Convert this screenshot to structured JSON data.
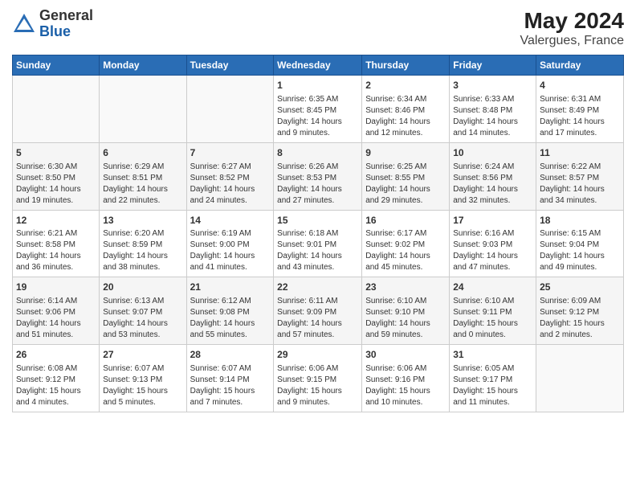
{
  "header": {
    "logo_general": "General",
    "logo_blue": "Blue",
    "month": "May 2024",
    "location": "Valergues, France"
  },
  "days_of_week": [
    "Sunday",
    "Monday",
    "Tuesday",
    "Wednesday",
    "Thursday",
    "Friday",
    "Saturday"
  ],
  "weeks": [
    [
      {
        "day": "",
        "content": ""
      },
      {
        "day": "",
        "content": ""
      },
      {
        "day": "",
        "content": ""
      },
      {
        "day": "1",
        "content": "Sunrise: 6:35 AM\nSunset: 8:45 PM\nDaylight: 14 hours\nand 9 minutes."
      },
      {
        "day": "2",
        "content": "Sunrise: 6:34 AM\nSunset: 8:46 PM\nDaylight: 14 hours\nand 12 minutes."
      },
      {
        "day": "3",
        "content": "Sunrise: 6:33 AM\nSunset: 8:48 PM\nDaylight: 14 hours\nand 14 minutes."
      },
      {
        "day": "4",
        "content": "Sunrise: 6:31 AM\nSunset: 8:49 PM\nDaylight: 14 hours\nand 17 minutes."
      }
    ],
    [
      {
        "day": "5",
        "content": "Sunrise: 6:30 AM\nSunset: 8:50 PM\nDaylight: 14 hours\nand 19 minutes."
      },
      {
        "day": "6",
        "content": "Sunrise: 6:29 AM\nSunset: 8:51 PM\nDaylight: 14 hours\nand 22 minutes."
      },
      {
        "day": "7",
        "content": "Sunrise: 6:27 AM\nSunset: 8:52 PM\nDaylight: 14 hours\nand 24 minutes."
      },
      {
        "day": "8",
        "content": "Sunrise: 6:26 AM\nSunset: 8:53 PM\nDaylight: 14 hours\nand 27 minutes."
      },
      {
        "day": "9",
        "content": "Sunrise: 6:25 AM\nSunset: 8:55 PM\nDaylight: 14 hours\nand 29 minutes."
      },
      {
        "day": "10",
        "content": "Sunrise: 6:24 AM\nSunset: 8:56 PM\nDaylight: 14 hours\nand 32 minutes."
      },
      {
        "day": "11",
        "content": "Sunrise: 6:22 AM\nSunset: 8:57 PM\nDaylight: 14 hours\nand 34 minutes."
      }
    ],
    [
      {
        "day": "12",
        "content": "Sunrise: 6:21 AM\nSunset: 8:58 PM\nDaylight: 14 hours\nand 36 minutes."
      },
      {
        "day": "13",
        "content": "Sunrise: 6:20 AM\nSunset: 8:59 PM\nDaylight: 14 hours\nand 38 minutes."
      },
      {
        "day": "14",
        "content": "Sunrise: 6:19 AM\nSunset: 9:00 PM\nDaylight: 14 hours\nand 41 minutes."
      },
      {
        "day": "15",
        "content": "Sunrise: 6:18 AM\nSunset: 9:01 PM\nDaylight: 14 hours\nand 43 minutes."
      },
      {
        "day": "16",
        "content": "Sunrise: 6:17 AM\nSunset: 9:02 PM\nDaylight: 14 hours\nand 45 minutes."
      },
      {
        "day": "17",
        "content": "Sunrise: 6:16 AM\nSunset: 9:03 PM\nDaylight: 14 hours\nand 47 minutes."
      },
      {
        "day": "18",
        "content": "Sunrise: 6:15 AM\nSunset: 9:04 PM\nDaylight: 14 hours\nand 49 minutes."
      }
    ],
    [
      {
        "day": "19",
        "content": "Sunrise: 6:14 AM\nSunset: 9:06 PM\nDaylight: 14 hours\nand 51 minutes."
      },
      {
        "day": "20",
        "content": "Sunrise: 6:13 AM\nSunset: 9:07 PM\nDaylight: 14 hours\nand 53 minutes."
      },
      {
        "day": "21",
        "content": "Sunrise: 6:12 AM\nSunset: 9:08 PM\nDaylight: 14 hours\nand 55 minutes."
      },
      {
        "day": "22",
        "content": "Sunrise: 6:11 AM\nSunset: 9:09 PM\nDaylight: 14 hours\nand 57 minutes."
      },
      {
        "day": "23",
        "content": "Sunrise: 6:10 AM\nSunset: 9:10 PM\nDaylight: 14 hours\nand 59 minutes."
      },
      {
        "day": "24",
        "content": "Sunrise: 6:10 AM\nSunset: 9:11 PM\nDaylight: 15 hours\nand 0 minutes."
      },
      {
        "day": "25",
        "content": "Sunrise: 6:09 AM\nSunset: 9:12 PM\nDaylight: 15 hours\nand 2 minutes."
      }
    ],
    [
      {
        "day": "26",
        "content": "Sunrise: 6:08 AM\nSunset: 9:12 PM\nDaylight: 15 hours\nand 4 minutes."
      },
      {
        "day": "27",
        "content": "Sunrise: 6:07 AM\nSunset: 9:13 PM\nDaylight: 15 hours\nand 5 minutes."
      },
      {
        "day": "28",
        "content": "Sunrise: 6:07 AM\nSunset: 9:14 PM\nDaylight: 15 hours\nand 7 minutes."
      },
      {
        "day": "29",
        "content": "Sunrise: 6:06 AM\nSunset: 9:15 PM\nDaylight: 15 hours\nand 9 minutes."
      },
      {
        "day": "30",
        "content": "Sunrise: 6:06 AM\nSunset: 9:16 PM\nDaylight: 15 hours\nand 10 minutes."
      },
      {
        "day": "31",
        "content": "Sunrise: 6:05 AM\nSunset: 9:17 PM\nDaylight: 15 hours\nand 11 minutes."
      },
      {
        "day": "",
        "content": ""
      }
    ]
  ]
}
